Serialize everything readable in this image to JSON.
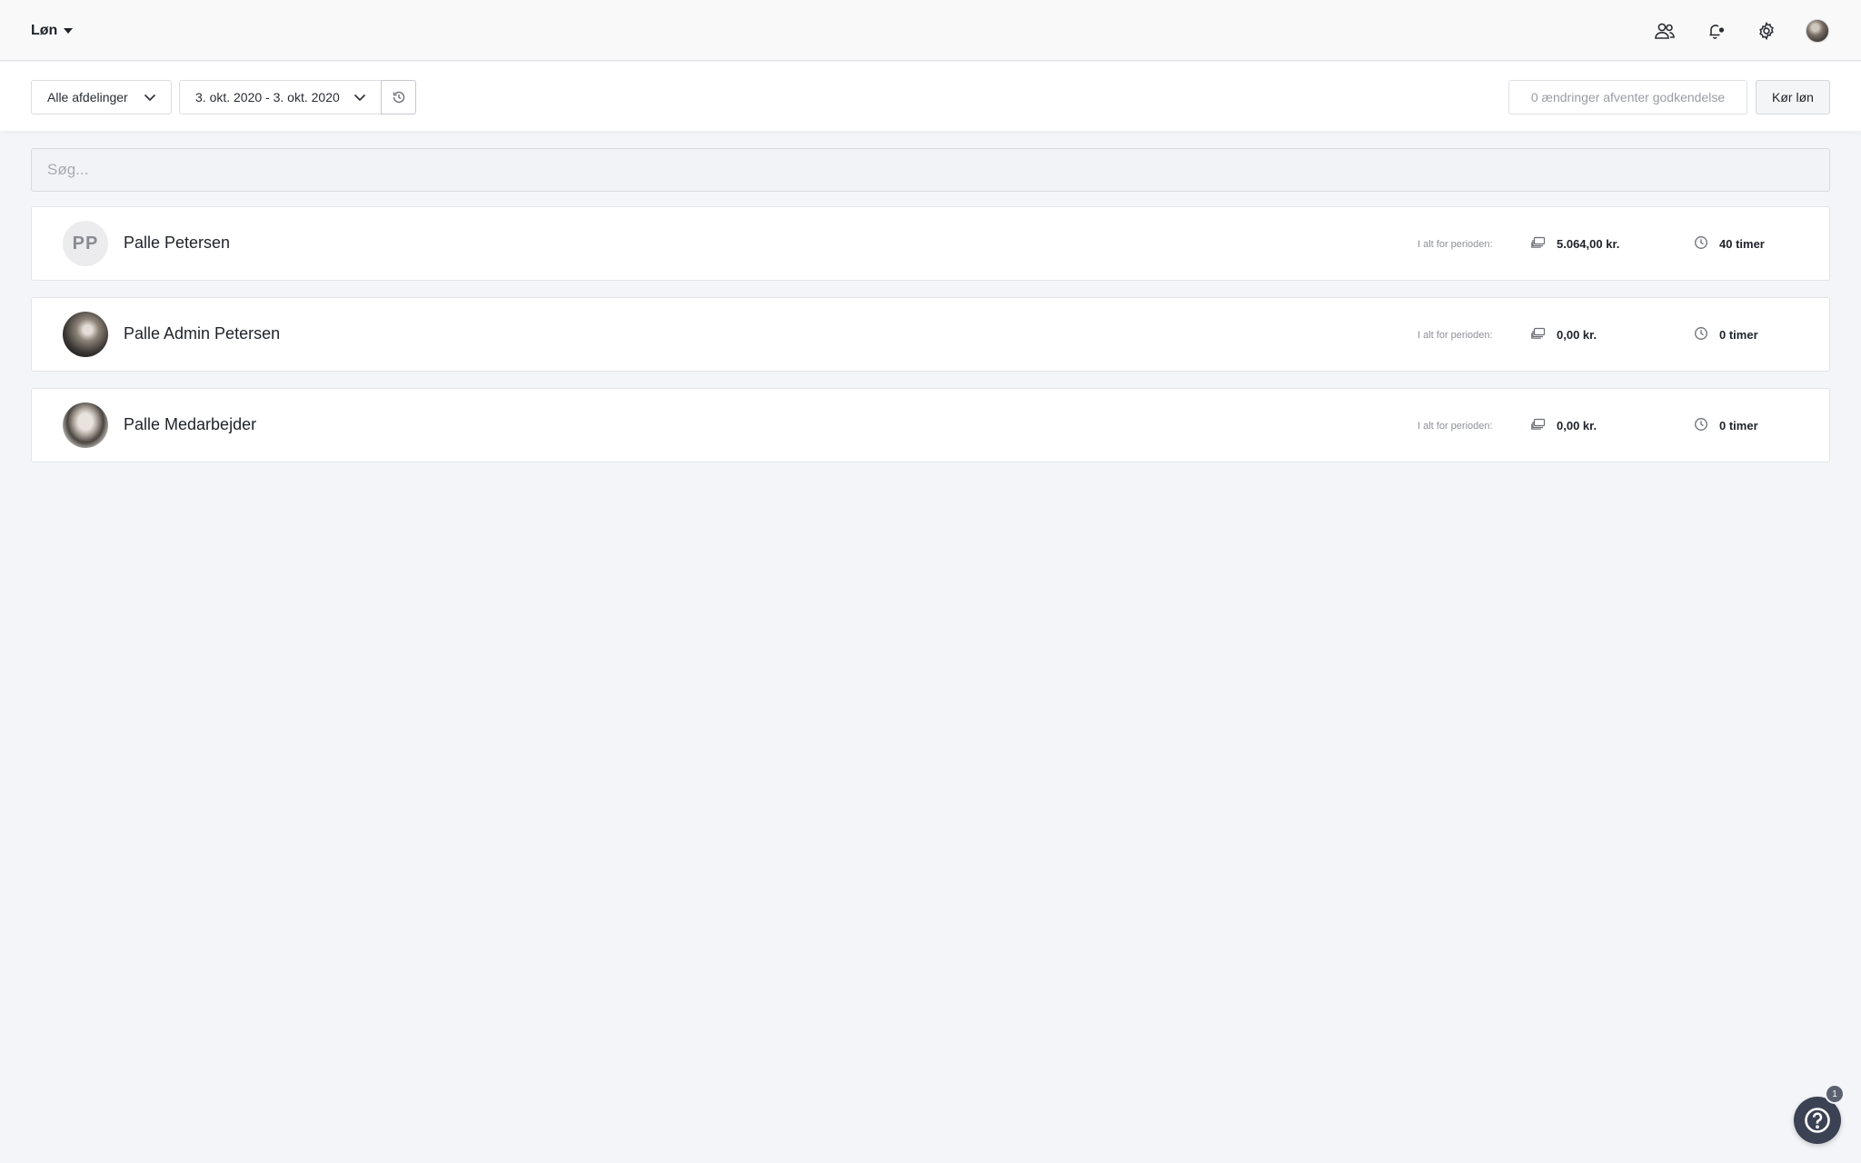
{
  "header": {
    "app_title": "Løn",
    "icons": [
      "users-icon",
      "bell-icon",
      "gear-icon",
      "avatar"
    ]
  },
  "toolbar": {
    "department_select": "Alle afdelinger",
    "date_range": "3. okt. 2020 - 3. okt. 2020",
    "pending_changes": "0 ændringer afventer godkendelse",
    "run_payroll_label": "Kør løn"
  },
  "search": {
    "placeholder": "Søg..."
  },
  "employees": [
    {
      "initials": "PP",
      "name": "Palle Petersen",
      "period_label": "I alt for perioden:",
      "amount": "5.064,00 kr.",
      "hours": "40 timer"
    },
    {
      "name": "Palle Admin Petersen",
      "period_label": "I alt for perioden:",
      "amount": "0,00 kr.",
      "hours": "0 timer"
    },
    {
      "name": "Palle Medarbejder",
      "period_label": "I alt for perioden:",
      "amount": "0,00 kr.",
      "hours": "0 timer"
    }
  ],
  "help": {
    "badge_count": "1"
  },
  "colors": {
    "background": "#f4f5f8",
    "help_button": "#3b4254"
  }
}
